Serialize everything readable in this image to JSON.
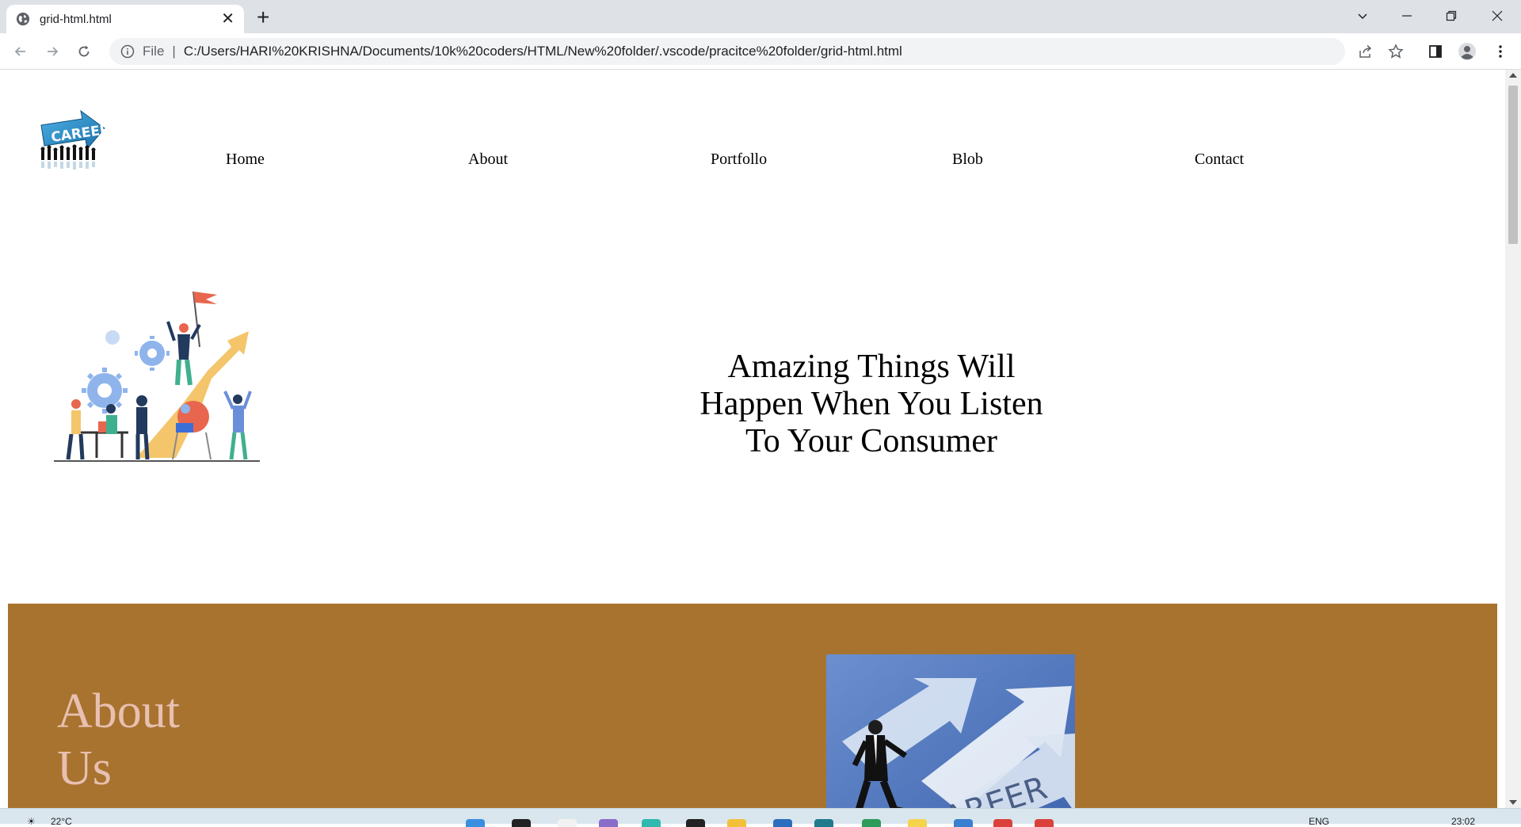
{
  "browser": {
    "tab_title": "grid-html.html",
    "new_tab_symbol": "+",
    "close_symbol": "✕",
    "url_scheme": "File",
    "url_separator": "|",
    "url": "C:/Users/HARI%20KRISHNA/Documents/10k%20coders/HTML/New%20folder/.vscode/pracitce%20folder/grid-html.html"
  },
  "page": {
    "logo_text": "CAREER",
    "nav": [
      {
        "label": "Home"
      },
      {
        "label": "About"
      },
      {
        "label": "Portfollo"
      },
      {
        "label": "Blob"
      },
      {
        "label": "Contact"
      }
    ],
    "hero": {
      "heading": "Amazing Things Will Happen When You Listen To Your Consumer"
    },
    "about": {
      "title": "About Us",
      "image_text": "CAREER"
    }
  },
  "taskbar": {
    "weather": "22°C",
    "language": "ENG",
    "time": "23:02"
  },
  "colors": {
    "about_band": "#a8732f",
    "about_title": "#e8c0b2",
    "chrome_bg": "#dee1e6"
  }
}
